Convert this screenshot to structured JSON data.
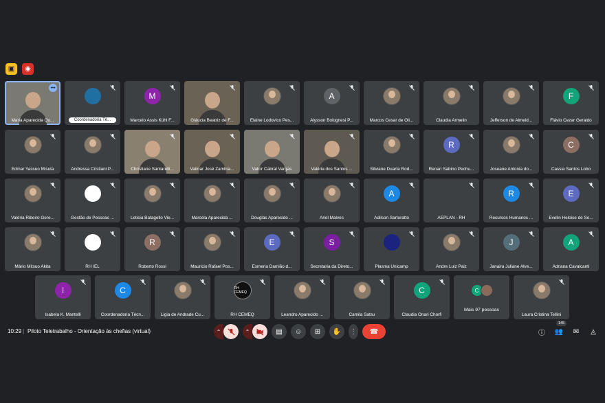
{
  "top_icons": [
    {
      "name": "recording-off-icon",
      "color": "#f6bf26"
    },
    {
      "name": "recording-icon",
      "color": "#d93025"
    }
  ],
  "rows": [
    [
      {
        "name": "Maria Aparecida Qu...",
        "type": "video",
        "active": true,
        "more": true
      },
      {
        "name": "",
        "type": "logo",
        "avatar_color": "#1f6fa3",
        "pill": "Coordenadoria Té..."
      },
      {
        "name": "Marcelo Assis Kühl F...",
        "type": "letter",
        "letter": "M",
        "avatar_color": "#8e24aa"
      },
      {
        "name": "Gláucia Beatriz de F...",
        "type": "video"
      },
      {
        "name": "Elaine Lodovico Pes...",
        "type": "photo"
      },
      {
        "name": "Alysson Bolognesi P...",
        "type": "letter",
        "letter": "A",
        "avatar_color": "#5f6368"
      },
      {
        "name": "Marcos Cesar de Oli...",
        "type": "photo"
      },
      {
        "name": "Claudia Armelin",
        "type": "photo"
      },
      {
        "name": "Jefferson de Almeid...",
        "type": "photo"
      },
      {
        "name": "Flávio Cezar Geraldo",
        "type": "letter",
        "letter": "F",
        "avatar_color": "#12a37a"
      }
    ],
    [
      {
        "name": "Edmar Yassuo Misuta",
        "type": "photo"
      },
      {
        "name": "Andressa Cristiani P...",
        "type": "photo"
      },
      {
        "name": "Christiane Santarelli...",
        "type": "video"
      },
      {
        "name": "Valmar José Zambra...",
        "type": "video"
      },
      {
        "name": "Valcir Cabral Vargas",
        "type": "video"
      },
      {
        "name": "Valéria dos Santos ...",
        "type": "video"
      },
      {
        "name": "Silviane Duarte Rod...",
        "type": "photo"
      },
      {
        "name": "Renan Sabino Pechu...",
        "type": "letter",
        "letter": "R",
        "avatar_color": "#5c6bc0"
      },
      {
        "name": "Joseane Antonia do...",
        "type": "photo"
      },
      {
        "name": "Cassia Santos Lobo",
        "type": "letter",
        "letter": "C",
        "avatar_color": "#8d6e63"
      }
    ],
    [
      {
        "name": "Valéria Ribeiro Gere...",
        "type": "photo"
      },
      {
        "name": "Gestão de Pessoas ...",
        "type": "logo",
        "avatar_color": "#ffffff"
      },
      {
        "name": "Leticia Batagello Vie...",
        "type": "photo"
      },
      {
        "name": "Marcela Aparecida ...",
        "type": "photo"
      },
      {
        "name": "Douglas Aparecido ...",
        "type": "photo"
      },
      {
        "name": "Ariel Malves",
        "type": "photo"
      },
      {
        "name": "Adilson Sartoratto",
        "type": "letter",
        "letter": "A",
        "avatar_color": "#1e88e5"
      },
      {
        "name": "AEPLAN - RH",
        "type": "logo",
        "avatar_color": "#3c4043"
      },
      {
        "name": "Recursos Humanos ...",
        "type": "letter",
        "letter": "R",
        "avatar_color": "#1e88e5"
      },
      {
        "name": "Evelin Heloise de So...",
        "type": "letter",
        "letter": "E",
        "avatar_color": "#5c6bc0"
      }
    ],
    [
      {
        "name": "Mário Mitsuo Akita",
        "type": "photo"
      },
      {
        "name": "RH IEL",
        "type": "logo",
        "avatar_color": "#ffffff"
      },
      {
        "name": "Roberto Rossi",
        "type": "letter",
        "letter": "R",
        "avatar_color": "#8d6e63"
      },
      {
        "name": "Mauricio Rafael Pos...",
        "type": "photo"
      },
      {
        "name": "Esmeria Damião d...",
        "type": "letter",
        "letter": "E",
        "avatar_color": "#5c6bc0"
      },
      {
        "name": "Secretaria da Direto...",
        "type": "letter",
        "letter": "S",
        "avatar_color": "#7b1fa2"
      },
      {
        "name": "Plasma Unicamp",
        "type": "logo",
        "avatar_color": "#1a237e"
      },
      {
        "name": "Andre Luiz Paiz",
        "type": "photo"
      },
      {
        "name": "Janaira Juliane Alve...",
        "type": "letter",
        "letter": "J",
        "avatar_color": "#546e7a"
      },
      {
        "name": "Adriana Cavalcanti",
        "type": "letter",
        "letter": "A",
        "avatar_color": "#12a37a"
      }
    ],
    [
      {
        "name": "Isabela K. Mantelli",
        "type": "letter",
        "letter": "I",
        "avatar_color": "#8e24aa"
      },
      {
        "name": "Coordenadoria Técn...",
        "type": "letter",
        "letter": "C",
        "avatar_color": "#1e88e5"
      },
      {
        "name": "Ligia de Andrade Cu...",
        "type": "photo"
      },
      {
        "name": "RH CEMEQ",
        "type": "logo",
        "avatar_color": "#111111",
        "logo_text": "RH CEMEQ"
      },
      {
        "name": "Leandro Aparecido ...",
        "type": "photo"
      },
      {
        "name": "Camila Satsu",
        "type": "photo"
      },
      {
        "name": "Claudia Onari Chorfi",
        "type": "letter",
        "letter": "C",
        "avatar_color": "#12a37a"
      },
      {
        "name": "Mais 97 pessoas",
        "type": "more",
        "letter": "C",
        "avatar_color": "#12a37a"
      },
      {
        "name": "Laura Cristina Tellini",
        "type": "photo"
      }
    ]
  ],
  "bottom": {
    "time": "10:29",
    "separator": "|",
    "meeting_title": "Piloto Teletrabalho - Orientação às chefias (virtual)",
    "people_count": "145"
  }
}
